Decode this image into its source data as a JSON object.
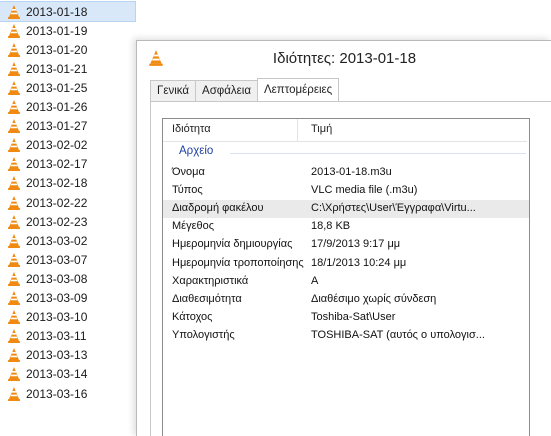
{
  "explorer": {
    "files": [
      {
        "name": "2013-01-18",
        "selected": true
      },
      {
        "name": "2013-01-19",
        "selected": false
      },
      {
        "name": "2013-01-20",
        "selected": false
      },
      {
        "name": "2013-01-21",
        "selected": false
      },
      {
        "name": "2013-01-25",
        "selected": false
      },
      {
        "name": "2013-01-26",
        "selected": false
      },
      {
        "name": "2013-01-27",
        "selected": false
      },
      {
        "name": "2013-02-02",
        "selected": false
      },
      {
        "name": "2013-02-17",
        "selected": false
      },
      {
        "name": "2013-02-18",
        "selected": false
      },
      {
        "name": "2013-02-22",
        "selected": false
      },
      {
        "name": "2013-02-23",
        "selected": false
      },
      {
        "name": "2013-03-02",
        "selected": false
      },
      {
        "name": "2013-03-07",
        "selected": false
      },
      {
        "name": "2013-03-08",
        "selected": false
      },
      {
        "name": "2013-03-09",
        "selected": false
      },
      {
        "name": "2013-03-10",
        "selected": false
      },
      {
        "name": "2013-03-11",
        "selected": false
      },
      {
        "name": "2013-03-13",
        "selected": false
      },
      {
        "name": "2013-03-14",
        "selected": false
      },
      {
        "name": "2013-03-16",
        "selected": false
      }
    ],
    "file_icon": "vlc-cone-icon"
  },
  "dialog": {
    "title": "Ιδιότητες: 2013-01-18",
    "title_icon": "vlc-cone-icon",
    "tabs": [
      {
        "label": "Γενικά",
        "active": false
      },
      {
        "label": "Ασφάλεια",
        "active": false
      },
      {
        "label": "Λεπτομέρειες",
        "active": true
      }
    ],
    "columns": {
      "property": "Ιδιότητα",
      "value": "Τιμή"
    },
    "group": "Αρχείο",
    "properties": [
      {
        "name": "Όνομα",
        "value": "2013-01-18.m3u",
        "highlighted": false
      },
      {
        "name": "Τύπος",
        "value": "VLC media file (.m3u)",
        "highlighted": false
      },
      {
        "name": "Διαδρομή φακέλου",
        "value": "C:\\Χρήστες\\User\\Έγγραφα\\Virtu...",
        "highlighted": true
      },
      {
        "name": "Μέγεθος",
        "value": "18,8 KB",
        "highlighted": false
      },
      {
        "name": "Ημερομηνία δημιουργίας",
        "value": "17/9/2013 9:17 μμ",
        "highlighted": false
      },
      {
        "name": "Ημερομηνία τροποποίησης",
        "value": "18/1/2013 10:24 μμ",
        "highlighted": false
      },
      {
        "name": "Χαρακτηριστικά",
        "value": "A",
        "highlighted": false
      },
      {
        "name": "Διαθεσιμότητα",
        "value": "Διαθέσιμο χωρίς σύνδεση",
        "highlighted": false
      },
      {
        "name": "Κάτοχος",
        "value": "Toshiba-Sat\\User",
        "highlighted": false
      },
      {
        "name": "Υπολογιστής",
        "value": "TOSHIBA-SAT (αυτός ο υπολογισ...",
        "highlighted": false
      }
    ]
  },
  "colors": {
    "cone_orange": "#f08a12",
    "cone_stripe": "#ffffff",
    "selection": "#d9e8f8",
    "group_label": "#1e3fa6"
  }
}
